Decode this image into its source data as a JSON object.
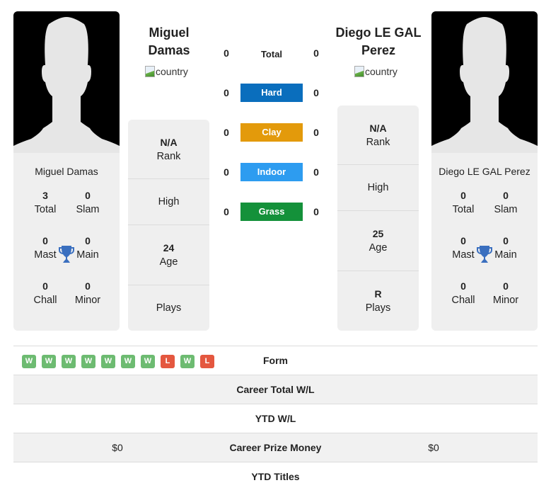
{
  "colors": {
    "hard": "#0a6ebd",
    "clay": "#e39a0b",
    "indoor": "#2d9cf0",
    "grass": "#14913a",
    "win": "#6dbb71",
    "loss": "#e4573f",
    "trophy": "#3a6fbf"
  },
  "player1": {
    "name": "Miguel Damas",
    "name_line1": "Miguel",
    "name_line2": "Damas",
    "flag_alt": "country",
    "titles": {
      "total": "3",
      "total_label": "Total",
      "slam": "0",
      "slam_label": "Slam",
      "mast": "0",
      "mast_label": "Mast",
      "main": "0",
      "main_label": "Main",
      "chall": "0",
      "chall_label": "Chall",
      "minor": "0",
      "minor_label": "Minor"
    },
    "info": {
      "rank": "N/A",
      "rank_label": "Rank",
      "high": "",
      "high_label": "High",
      "age": "24",
      "age_label": "Age",
      "plays": "",
      "plays_label": "Plays"
    }
  },
  "player2": {
    "name": "Diego LE GAL Perez",
    "name_line1": "Diego LE GAL",
    "name_line2": "Perez",
    "flag_alt": "country",
    "titles": {
      "total": "0",
      "total_label": "Total",
      "slam": "0",
      "slam_label": "Slam",
      "mast": "0",
      "mast_label": "Mast",
      "main": "0",
      "main_label": "Main",
      "chall": "0",
      "chall_label": "Chall",
      "minor": "0",
      "minor_label": "Minor"
    },
    "info": {
      "rank": "N/A",
      "rank_label": "Rank",
      "high": "",
      "high_label": "High",
      "age": "25",
      "age_label": "Age",
      "plays": "R",
      "plays_label": "Plays"
    }
  },
  "surfaces": [
    {
      "label": "Total",
      "p1": "0",
      "p2": "0"
    },
    {
      "label": "Hard",
      "p1": "0",
      "p2": "0"
    },
    {
      "label": "Clay",
      "p1": "0",
      "p2": "0"
    },
    {
      "label": "Indoor",
      "p1": "0",
      "p2": "0"
    },
    {
      "label": "Grass",
      "p1": "0",
      "p2": "0"
    }
  ],
  "form": [
    "W",
    "W",
    "W",
    "W",
    "W",
    "W",
    "W",
    "L",
    "W",
    "L"
  ],
  "comparison": [
    {
      "label": "Form",
      "p1": "",
      "p2": ""
    },
    {
      "label": "Career Total W/L",
      "p1": "",
      "p2": ""
    },
    {
      "label": "YTD W/L",
      "p1": "",
      "p2": ""
    },
    {
      "label": "Career Prize Money",
      "p1": "$0",
      "p2": "$0"
    },
    {
      "label": "YTD Titles",
      "p1": "",
      "p2": ""
    }
  ]
}
